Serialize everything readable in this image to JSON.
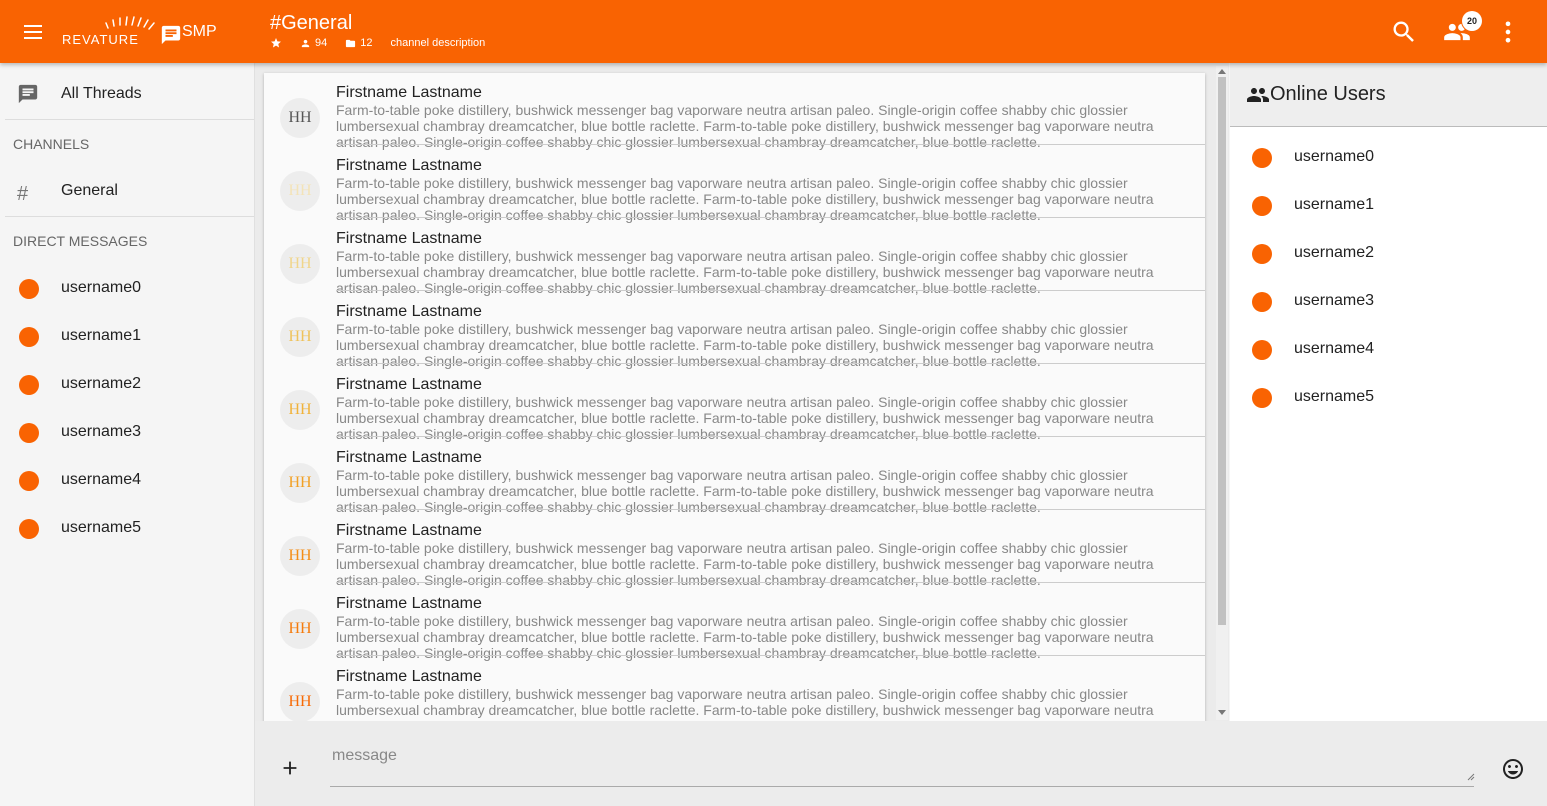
{
  "toolbar": {
    "logo_text": "REVATURE",
    "app_name": "SMP",
    "channel_title": "#General",
    "members_count": "94",
    "folders_count": "12",
    "channel_description": "channel description",
    "notification_count": "20"
  },
  "sidebar": {
    "all_threads": "All Threads",
    "channels_header": "CHANNELS",
    "channels": [
      {
        "label": "General"
      }
    ],
    "dm_header": "DIRECT MESSAGES",
    "direct_messages": [
      {
        "label": "username0"
      },
      {
        "label": "username1"
      },
      {
        "label": "username2"
      },
      {
        "label": "username3"
      },
      {
        "label": "username4"
      },
      {
        "label": "username5"
      }
    ]
  },
  "messages": [
    {
      "initials": "HH",
      "initials_color": "#555555",
      "name": "Firstname Lastname",
      "text": "Farm-to-table poke distillery, bushwick messenger bag vaporware neutra artisan paleo. Single-origin coffee shabby chic glossier lumbersexual chambray dreamcatcher, blue bottle raclette. Farm-to-table poke distillery, bushwick messenger bag vaporware neutra artisan paleo. Single-origin coffee shabby chic glossier lumbersexual chambray dreamcatcher, blue bottle raclette."
    },
    {
      "initials": "HH",
      "initials_color": "#f3e3b8",
      "name": "Firstname Lastname",
      "text": "Farm-to-table poke distillery, bushwick messenger bag vaporware neutra artisan paleo. Single-origin coffee shabby chic glossier lumbersexual chambray dreamcatcher, blue bottle raclette. Farm-to-table poke distillery, bushwick messenger bag vaporware neutra artisan paleo. Single-origin coffee shabby chic glossier lumbersexual chambray dreamcatcher, blue bottle raclette."
    },
    {
      "initials": "HH",
      "initials_color": "#f0d58a",
      "name": "Firstname Lastname",
      "text": "Farm-to-table poke distillery, bushwick messenger bag vaporware neutra artisan paleo. Single-origin coffee shabby chic glossier lumbersexual chambray dreamcatcher, blue bottle raclette. Farm-to-table poke distillery, bushwick messenger bag vaporware neutra artisan paleo. Single-origin coffee shabby chic glossier lumbersexual chambray dreamcatcher, blue bottle raclette."
    },
    {
      "initials": "HH",
      "initials_color": "#efc25a",
      "name": "Firstname Lastname",
      "text": "Farm-to-table poke distillery, bushwick messenger bag vaporware neutra artisan paleo. Single-origin coffee shabby chic glossier lumbersexual chambray dreamcatcher, blue bottle raclette. Farm-to-table poke distillery, bushwick messenger bag vaporware neutra artisan paleo. Single-origin coffee shabby chic glossier lumbersexual chambray dreamcatcher, blue bottle raclette."
    },
    {
      "initials": "HH",
      "initials_color": "#f0b23a",
      "name": "Firstname Lastname",
      "text": "Farm-to-table poke distillery, bushwick messenger bag vaporware neutra artisan paleo. Single-origin coffee shabby chic glossier lumbersexual chambray dreamcatcher, blue bottle raclette. Farm-to-table poke distillery, bushwick messenger bag vaporware neutra artisan paleo. Single-origin coffee shabby chic glossier lumbersexual chambray dreamcatcher, blue bottle raclette."
    },
    {
      "initials": "HH",
      "initials_color": "#f2a024",
      "name": "Firstname Lastname",
      "text": "Farm-to-table poke distillery, bushwick messenger bag vaporware neutra artisan paleo. Single-origin coffee shabby chic glossier lumbersexual chambray dreamcatcher, blue bottle raclette. Farm-to-table poke distillery, bushwick messenger bag vaporware neutra artisan paleo. Single-origin coffee shabby chic glossier lumbersexual chambray dreamcatcher, blue bottle raclette."
    },
    {
      "initials": "HH",
      "initials_color": "#f48d16",
      "name": "Firstname Lastname",
      "text": "Farm-to-table poke distillery, bushwick messenger bag vaporware neutra artisan paleo. Single-origin coffee shabby chic glossier lumbersexual chambray dreamcatcher, blue bottle raclette. Farm-to-table poke distillery, bushwick messenger bag vaporware neutra artisan paleo. Single-origin coffee shabby chic glossier lumbersexual chambray dreamcatcher, blue bottle raclette."
    },
    {
      "initials": "HH",
      "initials_color": "#f57b0c",
      "name": "Firstname Lastname",
      "text": "Farm-to-table poke distillery, bushwick messenger bag vaporware neutra artisan paleo. Single-origin coffee shabby chic glossier lumbersexual chambray dreamcatcher, blue bottle raclette. Farm-to-table poke distillery, bushwick messenger bag vaporware neutra artisan paleo. Single-origin coffee shabby chic glossier lumbersexual chambray dreamcatcher, blue bottle raclette."
    },
    {
      "initials": "HH",
      "initials_color": "#f76a05",
      "name": "Firstname Lastname",
      "text": "Farm-to-table poke distillery, bushwick messenger bag vaporware neutra artisan paleo. Single-origin coffee shabby chic glossier lumbersexual chambray dreamcatcher, blue bottle raclette. Farm-to-table poke distillery, bushwick messenger bag vaporware neutra artisan paleo. Single-origin coffee shabby chic glossier lumbersexual chambray dreamcatcher, blue bottle raclette."
    }
  ],
  "online_users": {
    "title": "Online Users",
    "users": [
      {
        "label": "username0"
      },
      {
        "label": "username1"
      },
      {
        "label": "username2"
      },
      {
        "label": "username3"
      },
      {
        "label": "username4"
      },
      {
        "label": "username5"
      }
    ]
  },
  "composer": {
    "placeholder": "message",
    "add_icon": "plus-icon",
    "emoji_icon": "emoji-smile-icon"
  },
  "colors": {
    "brand": "#f96302"
  }
}
